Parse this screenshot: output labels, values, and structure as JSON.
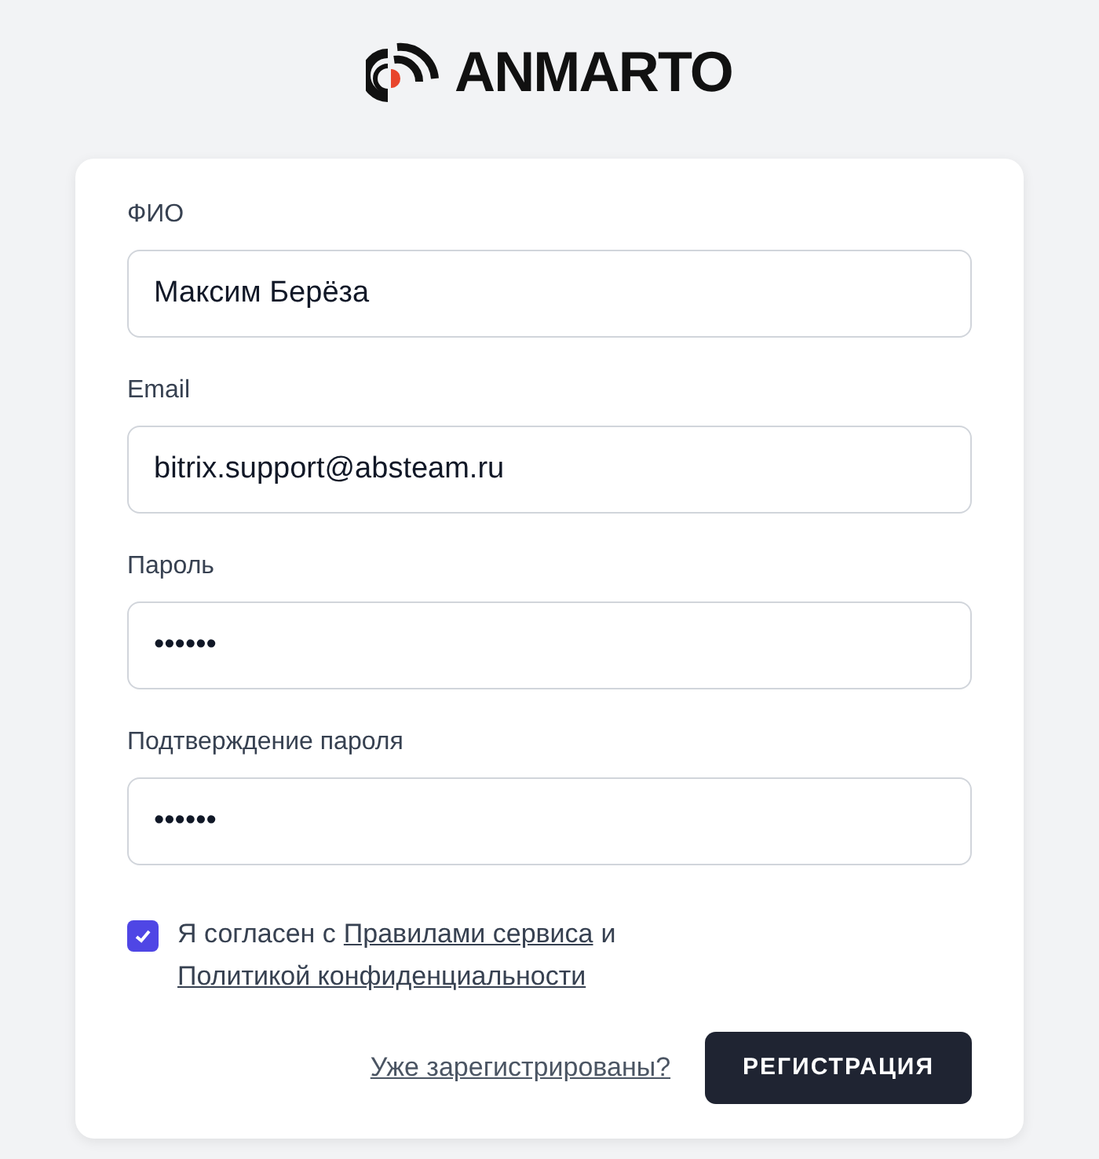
{
  "logo": {
    "text": "ANMARTO"
  },
  "fields": [
    {
      "label": "ФИО",
      "value": "Максим Берёза"
    },
    {
      "label": "Email",
      "value": "bitrix.support@absteam.ru"
    },
    {
      "label": "Пароль",
      "value": "••••••"
    },
    {
      "label": "Подтверждение пароля",
      "value": "••••••"
    }
  ],
  "agreement": {
    "checked": true,
    "parts": [
      {
        "kind": "text",
        "text": "Я согласен с"
      },
      {
        "kind": "link",
        "text": "Правилами сервиса"
      },
      {
        "kind": "text",
        "text": "и"
      },
      {
        "kind": "link",
        "text": "Политикой конфиденциальности"
      }
    ]
  },
  "login_link": "Уже зарегистрированы?",
  "submit_button": "РЕГИСТРАЦИЯ"
}
